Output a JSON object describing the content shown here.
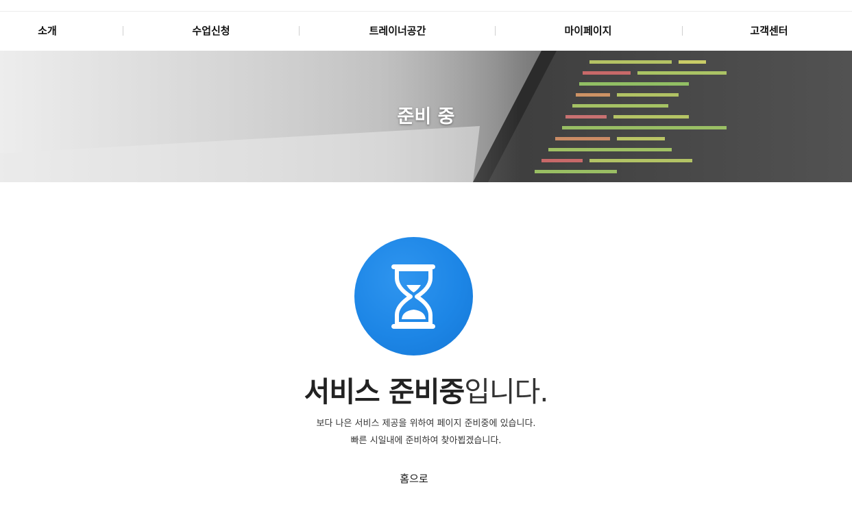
{
  "nav": {
    "items": [
      {
        "label": "소개"
      },
      {
        "label": "수업신청"
      },
      {
        "label": "트레이너공간"
      },
      {
        "label": "마이페이지"
      },
      {
        "label": "고객센터"
      }
    ]
  },
  "banner": {
    "title": "준비 중"
  },
  "notice": {
    "icon": "hourglass-icon",
    "headline_strong": "서비스 준비중",
    "headline_light": "입니다.",
    "line1": "보다 나은 서비스 제공을 위하여 페이지 준비중에 있습니다.",
    "line2": "빠른 시일내에 준비하여 찾아뵙겠습니다.",
    "home_label": "홈으로"
  },
  "colors": {
    "accent": "#1d86e6"
  }
}
